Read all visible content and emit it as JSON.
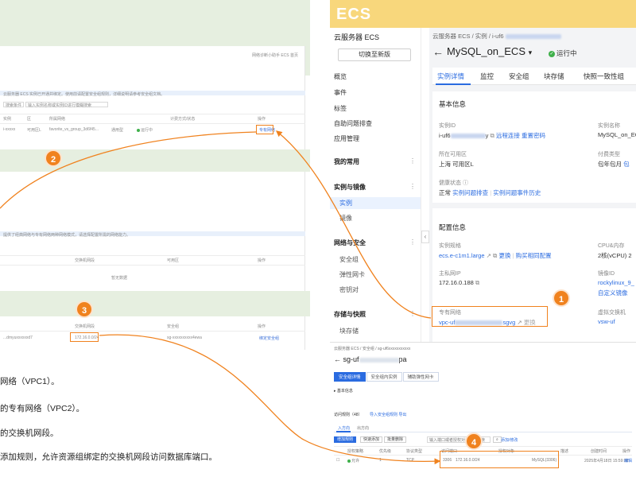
{
  "ecs_banner": "ECS",
  "left": {
    "top_right_links": "网络诊断小助手   ECS 首页",
    "info_text": "云服务器 ECS 实例已开通并绑定。使用前请配置安全组规则，详细说明请参考安全组文档。",
    "search_select": "搜索条件",
    "search_placeholder": "输入实例名称或实例ID进行模糊搜索",
    "table1_headers": [
      "实例",
      "区",
      "所属网络",
      "",
      "",
      "计费方式/状态",
      "操作"
    ],
    "table1_row": {
      "id": "i-xxxxx",
      "az": "可用区L",
      "vpc": "favorite_vs_group_3d6f45...",
      "type": "通用型",
      "status": "运行中",
      "action": "专有网络"
    },
    "mid_text": "提供了经典网络与专有网络两种网络模式，请选择配置所需的网络能力。",
    "table2_headers": [
      "交换机网段",
      "可用区",
      "操作"
    ],
    "table2_empty": "暂无数据",
    "table3_headers": [
      "交换机网段",
      "安全组",
      "操作"
    ],
    "table3_row": {
      "id": "...dmyuxxxxxxd7",
      "cidr": "172.16.0.0/24",
      "sg": "sg-xxxxxxxxxx4ewa",
      "action": "绑定安全组"
    },
    "steps": [
      "网络（VPC1）。",
      "的专有网络（VPC2）。",
      "的交换机网段。",
      "添加规则，允许资源组绑定的交换机网段访问数据库端口。"
    ]
  },
  "sidebar": {
    "title": "云服务器 ECS",
    "switch_button": "切换至新版",
    "items": [
      {
        "label": "概览",
        "type": "item"
      },
      {
        "label": "事件",
        "type": "item"
      },
      {
        "label": "标签",
        "type": "item"
      },
      {
        "label": "自助问题排查",
        "type": "item"
      },
      {
        "label": "应用管理",
        "type": "item"
      },
      {
        "label": "我的常用",
        "type": "group"
      },
      {
        "label": "实例与镜像",
        "type": "group"
      },
      {
        "label": "实例",
        "type": "active"
      },
      {
        "label": "镜像",
        "type": "sub"
      },
      {
        "label": "网络与安全",
        "type": "group"
      },
      {
        "label": "安全组",
        "type": "sub"
      },
      {
        "label": "弹性网卡",
        "type": "sub"
      },
      {
        "label": "密钥对",
        "type": "sub"
      },
      {
        "label": "存储与快照",
        "type": "group"
      },
      {
        "label": "块存储",
        "type": "sub"
      }
    ],
    "collapse": "‹"
  },
  "main": {
    "breadcrumb": "云服务器 ECS  /  实例  /  i-uf6",
    "instance_name": "MySQL_on_ECS",
    "status": "运行中",
    "tabs": [
      "实例详情",
      "监控",
      "安全组",
      "块存储",
      "快照一致性组"
    ],
    "basic_info": {
      "title": "基本信息",
      "instance_id_label": "实例ID",
      "instance_id_value": "i-uf6",
      "instance_id_suffix": "y",
      "remote_connect": "远程连接",
      "reset_password": "重置密码",
      "name_label": "实例名称",
      "name_value": "MySQL_on_EC",
      "zone_label": "所在可用区",
      "zone_value": "上海 可用区L",
      "billing_label": "付费类型",
      "billing_value": "包年包月",
      "billing_link": "包",
      "health_label": "健康状态",
      "health_value": "正常",
      "health_link1": "实例问题排查",
      "health_link2": "实例问题事件历史"
    },
    "config_info": {
      "title": "配置信息",
      "spec_label": "实例规格",
      "spec_value": "ecs.e-c1m1.large",
      "spec_change": "更换",
      "spec_buy": "购买相同配置",
      "cpu_label": "CPU&内存",
      "cpu_value": "2核(vCPU)  2",
      "ip_label": "主私网IP",
      "ip_value": "172.16.0.188",
      "image_label": "镜像ID",
      "image_value": "rockylinux_9_",
      "image_link": "自定义镜像",
      "vpc_label": "专有网络",
      "vpc_prefix": "vpc-uf",
      "vpc_suffix": "sgvg",
      "vpc_change": "更换",
      "vswitch_label": "虚拟交换机",
      "vswitch_value": "vsw-uf"
    }
  },
  "bottom_right": {
    "breadcrumb": "云服务器 ECS  /  安全组  /  sg-uf6xxxxxxxxxxx",
    "sg_title": "sg-uf",
    "sg_title_suffix": "pa",
    "tabs": [
      "安全组详情",
      "安全组内实例",
      "辅助弹性网卡"
    ],
    "basic_section": "基本信息",
    "rules_title": "访问规则（48）",
    "rules_links": "导入安全组规则   导出",
    "dir_tabs": [
      "入方向",
      "出方向"
    ],
    "buttons": [
      "增加规则",
      "快速添加",
      "批量删除",
      "添加/修改"
    ],
    "search_placeholder": "输入端口或者授权对象进行搜索",
    "headers": [
      "授权策略",
      "优先级",
      "协议类型",
      "访问端口",
      "授权对象",
      "描述",
      "创建时间",
      "操作"
    ],
    "row": {
      "policy": "允许",
      "priority": "1",
      "protocol": "TCP",
      "port": "3306",
      "source": "172.16.0.0/24",
      "desc": "MySQL(3306)",
      "time": "2025年4月18日 15:59:38",
      "action": "编辑"
    }
  },
  "callouts": [
    "1",
    "2",
    "3",
    "4"
  ],
  "colors": {
    "accent": "#f0821e",
    "link": "#2a6be0",
    "success": "#3fb04b",
    "banner": "#f8d77c"
  }
}
